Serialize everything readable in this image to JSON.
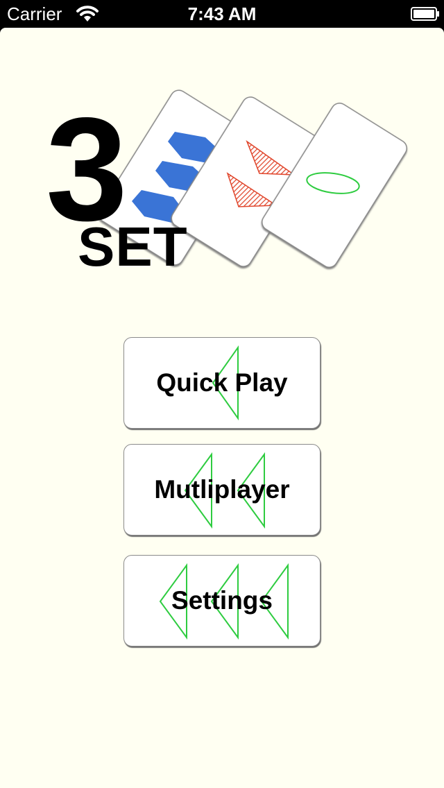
{
  "status_bar": {
    "carrier": "Carrier",
    "time": "7:43 AM",
    "wifi_icon": "wifi-icon",
    "battery_icon": "battery-icon"
  },
  "logo": {
    "number": "3",
    "word": "SET",
    "cards": [
      {
        "count": 3,
        "shape": "hexagon",
        "shading": "solid",
        "color": "#3a74d6"
      },
      {
        "count": 2,
        "shape": "triangle",
        "shading": "striped",
        "color": "#e0452b"
      },
      {
        "count": 1,
        "shape": "oval",
        "shading": "open",
        "color": "#2ecc40"
      }
    ]
  },
  "menu": {
    "quick_play": {
      "label": "Quick Play",
      "icon": "triangle-icon",
      "icon_count": 1
    },
    "multiplayer": {
      "label": "Mutliplayer",
      "icon": "triangle-icon",
      "icon_count": 2
    },
    "settings": {
      "label": "Settings",
      "icon": "triangle-icon",
      "icon_count": 3
    }
  },
  "colors": {
    "background": "#fffff2",
    "status_bar": "#000000",
    "accent_green": "#2ecc40",
    "blue": "#3a74d6",
    "red": "#e0452b"
  }
}
